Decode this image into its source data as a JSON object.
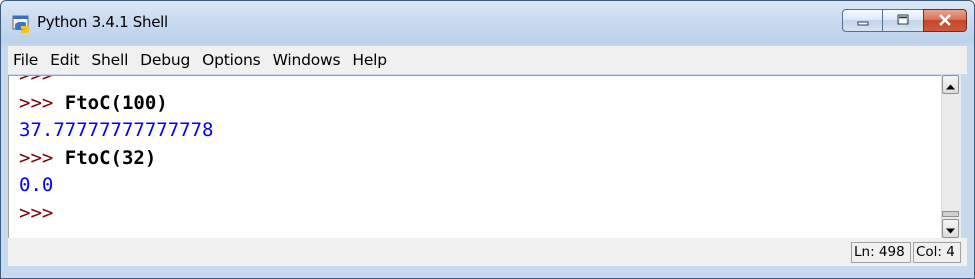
{
  "window": {
    "title": "Python 3.4.1 Shell",
    "controls": {
      "minimize": "minimize",
      "maximize": "maximize",
      "close": "close"
    }
  },
  "menubar": {
    "items": [
      {
        "label": "File"
      },
      {
        "label": "Edit"
      },
      {
        "label": "Shell"
      },
      {
        "label": "Debug"
      },
      {
        "label": "Options"
      },
      {
        "label": "Windows"
      },
      {
        "label": "Help"
      }
    ]
  },
  "shell": {
    "lines": [
      {
        "kind": "prompt",
        "prompt": ">>>",
        "text": ""
      },
      {
        "kind": "input",
        "prompt": ">>>",
        "text": "FtoC(100)"
      },
      {
        "kind": "output",
        "prompt": "",
        "text": "37.77777777777778"
      },
      {
        "kind": "input",
        "prompt": ">>>",
        "text": "FtoC(32)"
      },
      {
        "kind": "output",
        "prompt": "",
        "text": "0.0"
      },
      {
        "kind": "prompt",
        "prompt": ">>>",
        "text": ""
      }
    ]
  },
  "statusbar": {
    "line": "Ln: 498",
    "col": "Col: 4"
  },
  "colors": {
    "prompt": "#7f0000",
    "output": "#0000ff",
    "command": "#000000",
    "close_button": "#c6452a"
  },
  "icons": {
    "app": "python-shell-icon",
    "minimize": "minimize-icon",
    "maximize": "maximize-icon",
    "close": "close-icon",
    "scroll_up": "arrow-up-icon",
    "scroll_down": "arrow-down-icon"
  }
}
